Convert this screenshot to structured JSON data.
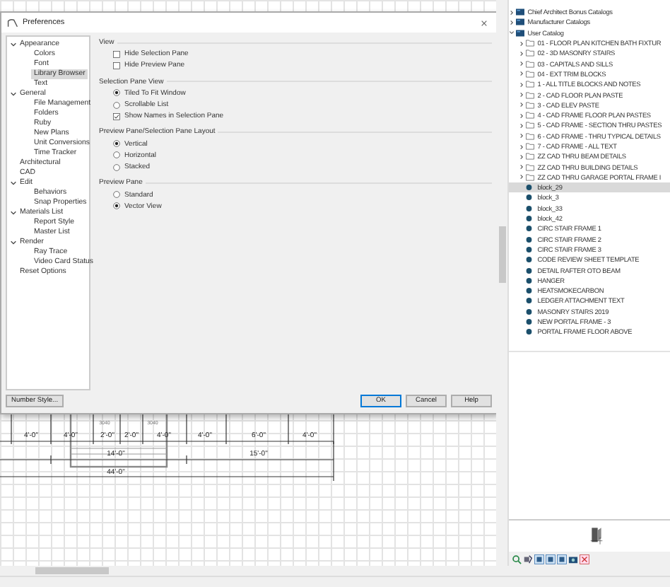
{
  "dialog": {
    "title": "Preferences",
    "categories": [
      {
        "label": "Appearance",
        "expanded": true,
        "selected": false,
        "children": [
          {
            "label": "Colors",
            "selected": false
          },
          {
            "label": "Font",
            "selected": false
          },
          {
            "label": "Library Browser",
            "selected": true
          },
          {
            "label": "Text",
            "selected": false
          }
        ]
      },
      {
        "label": "General",
        "expanded": true,
        "selected": false,
        "children": [
          {
            "label": "File Management",
            "selected": false
          },
          {
            "label": "Folders",
            "selected": false
          },
          {
            "label": "Ruby",
            "selected": false
          },
          {
            "label": "New Plans",
            "selected": false
          },
          {
            "label": "Unit Conversions",
            "selected": false
          },
          {
            "label": "Time Tracker",
            "selected": false
          }
        ]
      },
      {
        "label": "Architectural",
        "selected": false
      },
      {
        "label": "CAD",
        "selected": false
      },
      {
        "label": "Edit",
        "expanded": true,
        "selected": false,
        "children": [
          {
            "label": "Behaviors",
            "selected": false
          },
          {
            "label": "Snap Properties",
            "selected": false
          }
        ]
      },
      {
        "label": "Materials List",
        "expanded": true,
        "selected": false,
        "children": [
          {
            "label": "Report Style",
            "selected": false
          },
          {
            "label": "Master List",
            "selected": false
          }
        ]
      },
      {
        "label": "Render",
        "expanded": true,
        "selected": false,
        "children": [
          {
            "label": "Ray Trace",
            "selected": false
          },
          {
            "label": "Video Card Status",
            "selected": false
          }
        ]
      },
      {
        "label": "Reset Options",
        "selected": false
      }
    ],
    "sections": [
      {
        "title": "View",
        "options": [
          {
            "kind": "checkbox",
            "label": "Hide Selection Pane",
            "checked": false
          },
          {
            "kind": "checkbox",
            "label": "Hide Preview Pane",
            "checked": false
          }
        ]
      },
      {
        "title": "Selection Pane View",
        "options": [
          {
            "kind": "radio",
            "label": "Tiled To Fit Window",
            "selected": true
          },
          {
            "kind": "radio",
            "label": "Scrollable List",
            "selected": false
          },
          {
            "kind": "checkbox",
            "label": "Show Names in Selection Pane",
            "checked": true
          }
        ]
      },
      {
        "title": "Preview Pane/Selection Pane Layout",
        "options": [
          {
            "kind": "radio",
            "label": "Vertical",
            "selected": true
          },
          {
            "kind": "radio",
            "label": "Horizontal",
            "selected": false
          },
          {
            "kind": "radio",
            "label": "Stacked",
            "selected": false
          }
        ]
      },
      {
        "title": "Preview Pane",
        "options": [
          {
            "kind": "radio",
            "label": "Standard",
            "selected": false
          },
          {
            "kind": "radio",
            "label": "Vector View",
            "selected": true
          }
        ]
      }
    ],
    "number_style_button": "Number Style...",
    "buttons": [
      {
        "label": "OK",
        "default": true
      },
      {
        "label": "Cancel",
        "default": false
      },
      {
        "label": "Help",
        "default": false
      }
    ]
  },
  "canvas": {
    "window_labels": [
      "3040",
      "3040"
    ],
    "dimension_rows": [
      [
        "4'-0\"",
        "4'-0\"",
        "2'-0\"",
        "2'-0\"",
        "4'-0\"",
        "4'-0\"",
        "6'-0\"",
        "4'-0\""
      ],
      [
        "14'-0\"",
        "15'-0\""
      ],
      [
        "44'-0\""
      ]
    ]
  },
  "library": {
    "items": [
      {
        "kind": "catalog",
        "label": "Chief Architect Bonus Catalogs",
        "expanded": false,
        "selected": false
      },
      {
        "kind": "catalog",
        "label": "Manufacturer Catalogs",
        "expanded": false,
        "selected": false
      },
      {
        "kind": "catalog",
        "label": "User Catalog",
        "expanded": true,
        "selected": false,
        "children": [
          {
            "kind": "folder",
            "label": "01 - FLOOR PLAN KITCHEN BATH FIXTUR",
            "expanded": false,
            "selected": false
          },
          {
            "kind": "folder",
            "label": "02 - 3D MASONRY STAIRS",
            "expanded": false,
            "selected": false
          },
          {
            "kind": "folder",
            "label": "03 - CAPITALS AND SILLS",
            "expanded": false,
            "selected": false
          },
          {
            "kind": "folder",
            "label": "04 - EXT TRIM BLOCKS",
            "expanded": false,
            "selected": false
          },
          {
            "kind": "folder",
            "label": "1 - ALL TITLE BLOCKS AND NOTES",
            "expanded": false,
            "selected": false
          },
          {
            "kind": "folder",
            "label": "2 - CAD FLOOR PLAN PASTE",
            "expanded": false,
            "selected": false
          },
          {
            "kind": "folder",
            "label": "3 - CAD ELEV PASTE",
            "expanded": false,
            "selected": false
          },
          {
            "kind": "folder",
            "label": "4 - CAD FRAME FLOOR PLAN PASTES",
            "expanded": false,
            "selected": false
          },
          {
            "kind": "folder",
            "label": "5 - CAD FRAME - SECTION THRU PASTES",
            "expanded": false,
            "selected": false
          },
          {
            "kind": "folder",
            "label": "6 - CAD FRAME - THRU TYPICAL DETAILS",
            "expanded": false,
            "selected": false
          },
          {
            "kind": "folder",
            "label": "7 - CAD FRAME - ALL TEXT",
            "expanded": false,
            "selected": false
          },
          {
            "kind": "folder",
            "label": "ZZ CAD THRU BEAM DETAILS",
            "expanded": false,
            "selected": false
          },
          {
            "kind": "folder",
            "label": "ZZ CAD THRU BUILDING DETAILS",
            "expanded": false,
            "selected": false
          },
          {
            "kind": "folder",
            "label": "ZZ CAD THRU GARAGE PORTAL FRAME I",
            "expanded": false,
            "selected": false
          },
          {
            "kind": "block",
            "label": "block_29",
            "selected": true
          },
          {
            "kind": "block",
            "label": "block_3",
            "selected": false
          },
          {
            "kind": "block",
            "label": "block_33",
            "selected": false
          },
          {
            "kind": "block",
            "label": "block_42",
            "selected": false
          },
          {
            "kind": "block",
            "label": "CIRC STAIR FRAME 1",
            "selected": false
          },
          {
            "kind": "block",
            "label": "CIRC STAIR FRAME 2",
            "selected": false
          },
          {
            "kind": "block",
            "label": "CIRC STAIR FRAME 3",
            "selected": false
          },
          {
            "kind": "block",
            "label": "CODE REVIEW SHEET TEMPLATE",
            "selected": false
          },
          {
            "kind": "block",
            "label": "DETAIL RAFTER OTO BEAM",
            "selected": false
          },
          {
            "kind": "block",
            "label": "HANGER",
            "selected": false
          },
          {
            "kind": "block",
            "label": "HEATSMOKECARBON",
            "selected": false
          },
          {
            "kind": "block",
            "label": "LEDGER ATTACHMENT TEXT",
            "selected": false
          },
          {
            "kind": "block",
            "label": "MASONRY STAIRS 2019",
            "selected": false
          },
          {
            "kind": "block",
            "label": "NEW PORTAL FRAME - 3",
            "selected": false
          },
          {
            "kind": "block",
            "label": "PORTAL FRAME FLOOR ABOVE",
            "selected": false
          }
        ]
      }
    ]
  }
}
